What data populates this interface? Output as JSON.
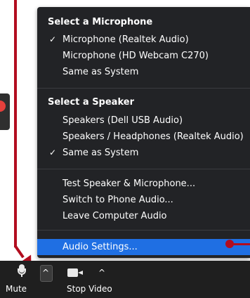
{
  "menu": {
    "microphone_title": "Select a Microphone",
    "microphones": [
      {
        "label": "Microphone (Realtek Audio)",
        "checked": true
      },
      {
        "label": "Microphone (HD Webcam C270)",
        "checked": false
      },
      {
        "label": "Same as System",
        "checked": false
      }
    ],
    "speaker_title": "Select a Speaker",
    "speakers": [
      {
        "label": "Speakers (Dell USB Audio)",
        "checked": false
      },
      {
        "label": "Speakers / Headphones (Realtek Audio)",
        "checked": false
      },
      {
        "label": "Same as System",
        "checked": true
      }
    ],
    "actions": [
      {
        "label": "Test Speaker & Microphone..."
      },
      {
        "label": "Switch to Phone Audio..."
      },
      {
        "label": "Leave Computer Audio"
      }
    ],
    "settings_label": "Audio Settings...",
    "checkmark": "✓"
  },
  "toolbar": {
    "mute_label": "Mute",
    "stop_video_label": "Stop Video",
    "caret": "^"
  },
  "icons": {
    "mic": "microphone-icon",
    "video": "video-camera-icon",
    "close": "close-icon",
    "check": "checkmark-icon"
  },
  "colors": {
    "menu_bg": "#222326",
    "highlight": "#1f6fe3",
    "annotation": "#b20d1f",
    "toolbar_bg": "#1f1f1f"
  }
}
